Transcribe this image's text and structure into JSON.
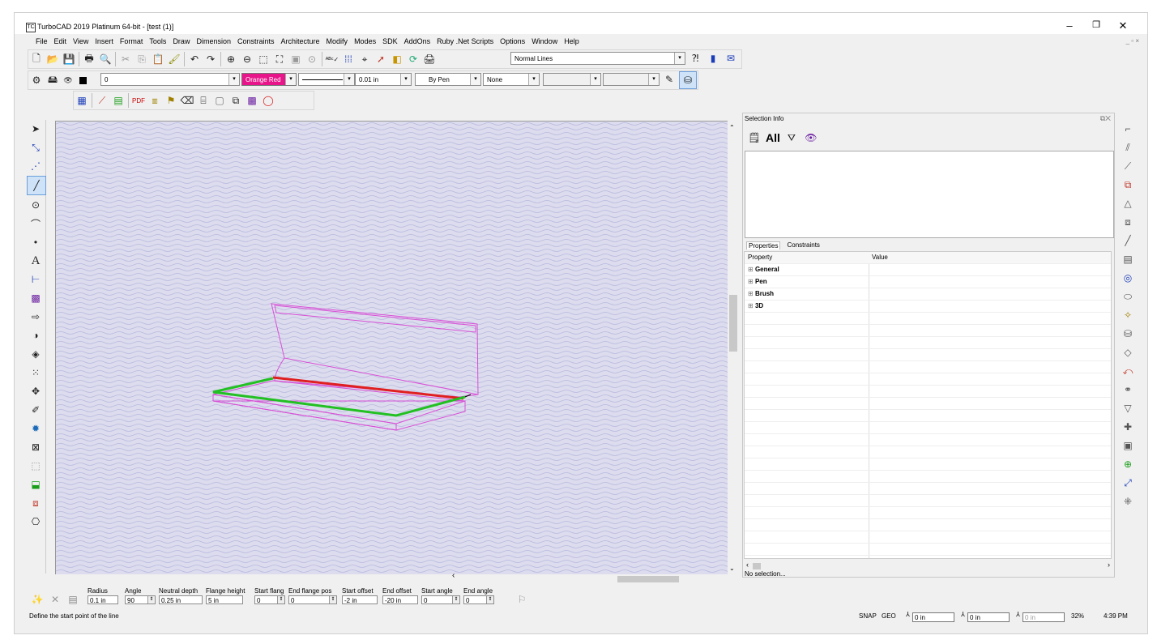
{
  "window": {
    "title": "TurboCAD 2019 Platinum 64-bit - [test (1)]",
    "app_icon": "TC",
    "controls": {
      "minimize": "–",
      "restore": "❐",
      "close": "✕"
    },
    "mdi_controls": "_ ▫ ×"
  },
  "menu": [
    "File",
    "Edit",
    "View",
    "Insert",
    "Format",
    "Tools",
    "Draw",
    "Dimension",
    "Constraints",
    "Architecture",
    "Modify",
    "Modes",
    "SDK",
    "AddOns",
    "Ruby .Net Scripts",
    "Options",
    "Window",
    "Help"
  ],
  "toolbar1": {
    "style_combo": "Normal Lines",
    "icons": [
      "new-icon",
      "open-icon",
      "save-icon",
      "print-icon",
      "print-preview-icon",
      "cut-icon",
      "copy-icon",
      "paste-icon",
      "format-painter-icon",
      "undo-icon",
      "redo-icon",
      "zoom-in-icon",
      "zoom-out-icon",
      "zoom-window-icon",
      "zoom-extents-icon",
      "zoom-page-icon",
      "zoom-previous-icon",
      "spelling-icon",
      "grid-icon",
      "snap-icon",
      "select-icon",
      "layer-icon",
      "render-icon",
      "print-setup-icon",
      "help-icon",
      "book-icon",
      "mail-icon"
    ]
  },
  "toolbar2": {
    "layer_value": "0",
    "color": "Orange Red",
    "color_hex": "#e8158a",
    "line_width": "0.01 in",
    "pen": "By Pen",
    "pattern": "None"
  },
  "properties_bar": {
    "fields": [
      {
        "label": "Radius",
        "value": "0.1 in",
        "spin": false
      },
      {
        "label": "Angle",
        "value": "90",
        "spin": true
      },
      {
        "label": "Neutral depth",
        "value": "0.25 in",
        "spin": false
      },
      {
        "label": "Flange height",
        "value": "5 in",
        "spin": false
      },
      {
        "label": "Start flang",
        "value": "0",
        "spin": true
      },
      {
        "label": "End flange pos",
        "value": "0",
        "spin": true
      },
      {
        "label": "Start offset",
        "value": "-2 in",
        "spin": false
      },
      {
        "label": "End offset",
        "value": "-20 in",
        "spin": false
      },
      {
        "label": "Start angle",
        "value": "0",
        "spin": true
      },
      {
        "label": "End angle",
        "value": "0",
        "spin": true
      }
    ]
  },
  "selection_panel": {
    "title": "Selection Info",
    "all_label": "All",
    "tabs": [
      "Properties",
      "Constraints"
    ],
    "columns": [
      "Property",
      "Value"
    ],
    "groups": [
      "General",
      "Pen",
      "Brush",
      "3D"
    ],
    "footer": "No selection..."
  },
  "status": {
    "prompt": "Define the start point of the line",
    "snap": "SNAP",
    "geo": "GEO",
    "x": "0 in",
    "y": "0 in",
    "z": "0 in",
    "zoom": "32%",
    "time": "4:39 PM"
  },
  "colors": {
    "model_pink": "#d94fd6",
    "highlight_red": "#e02020",
    "highlight_green": "#22c022",
    "canvas_bg": "#dcdcee"
  }
}
